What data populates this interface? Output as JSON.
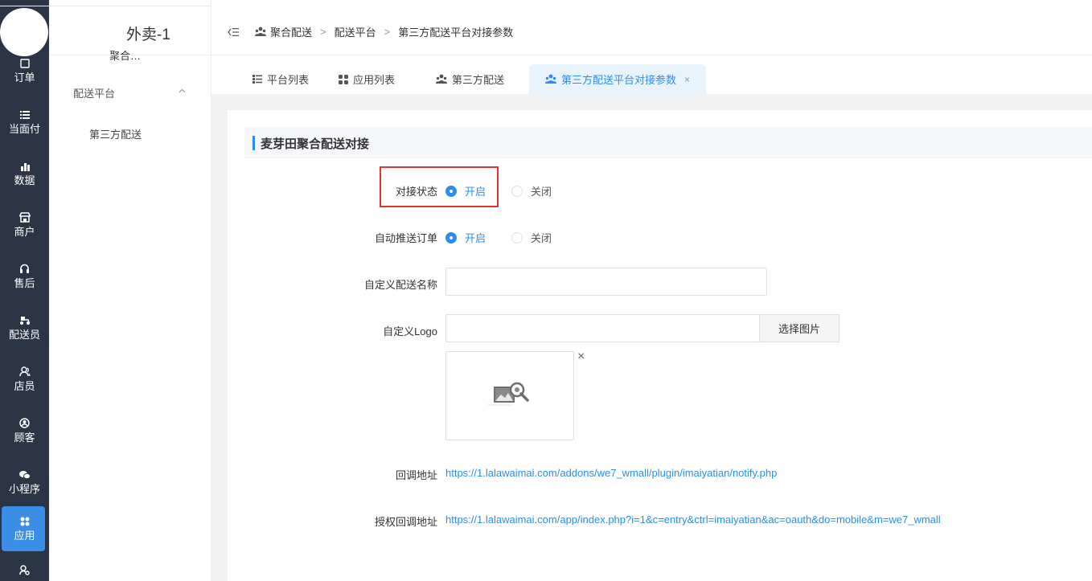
{
  "nav": {
    "items": [
      {
        "label": "订单",
        "icon": "order-icon"
      },
      {
        "label": "当面付",
        "icon": "list-icon"
      },
      {
        "label": "数据",
        "icon": "bar-chart-icon"
      },
      {
        "label": "商户",
        "icon": "store-icon"
      },
      {
        "label": "售后",
        "icon": "headset-icon"
      },
      {
        "label": "配送员",
        "icon": "scooter-icon"
      },
      {
        "label": "店员",
        "icon": "users-icon"
      },
      {
        "label": "顾客",
        "icon": "user-circle-icon"
      },
      {
        "label": "小程序",
        "icon": "wechat-icon"
      },
      {
        "label": "应用",
        "icon": "apps-icon"
      }
    ]
  },
  "sidebar": {
    "store_name": "外卖-1",
    "store_sub": "聚合…",
    "group_title": "配送平台",
    "items": [
      {
        "label": "第三方配送"
      }
    ]
  },
  "breadcrumb": [
    "聚合配送",
    "配送平台",
    "第三方配送平台对接参数"
  ],
  "tabs": [
    {
      "label": "平台列表"
    },
    {
      "label": "应用列表"
    },
    {
      "label": "第三方配送"
    },
    {
      "label": "第三方配送平台对接参数",
      "close": "×"
    }
  ],
  "section": {
    "title": "麦芽田聚合配送对接"
  },
  "form": {
    "status": {
      "label": "对接状态",
      "on": "开启",
      "off": "关闭",
      "selected": "开启"
    },
    "auto_push": {
      "label": "自动推送订单",
      "on": "开启",
      "off": "关闭",
      "selected": "开启"
    },
    "custom_name": {
      "label": "自定义配送名称",
      "value": ""
    },
    "custom_logo": {
      "label": "自定义Logo",
      "value": "",
      "button": "选择图片",
      "remove": "×"
    },
    "callback": {
      "label": "回调地址",
      "url": "https://1.lalawaimai.com/addons/we7_wmall/plugin/imaiyatian/notify.php"
    },
    "auth_callback": {
      "label": "授权回调地址",
      "url": "https://1.lalawaimai.com/app/index.php?i=1&c=entry&ctrl=imaiyatian&ac=oauth&do=mobile&m=we7_wmall"
    }
  },
  "colors": {
    "accent": "#2d8cf0",
    "nav_bg": "#2b3545",
    "highlight": "#e03434"
  }
}
